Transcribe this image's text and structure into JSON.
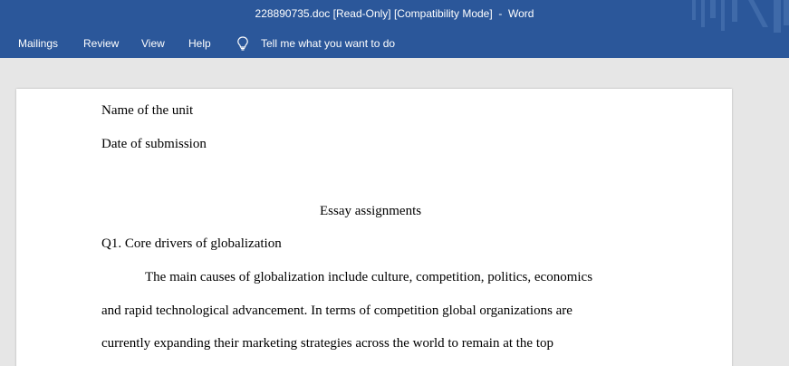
{
  "window": {
    "title": "228890735.doc [Read-Only] [Compatibility Mode]  -  Word"
  },
  "ribbon": {
    "tabs": [
      {
        "label": "Mailings"
      },
      {
        "label": "Review"
      },
      {
        "label": "View"
      },
      {
        "label": "Help"
      }
    ],
    "tell_me": {
      "label": "Tell me what you want to do",
      "icon": "lightbulb-icon"
    }
  },
  "colors": {
    "titlebar": "#2b579a",
    "workspace": "#e6e6e6",
    "page": "#ffffff"
  },
  "document": {
    "lines": [
      "Name of the unit",
      "Date of submission",
      "Essay assignments",
      "Q1. Core drivers of globalization",
      "The main causes of globalization include culture, competition, politics, economics",
      "and rapid technological advancement. In terms of competition global organizations are",
      "currently expanding their marketing strategies across the world to remain at the top"
    ]
  }
}
